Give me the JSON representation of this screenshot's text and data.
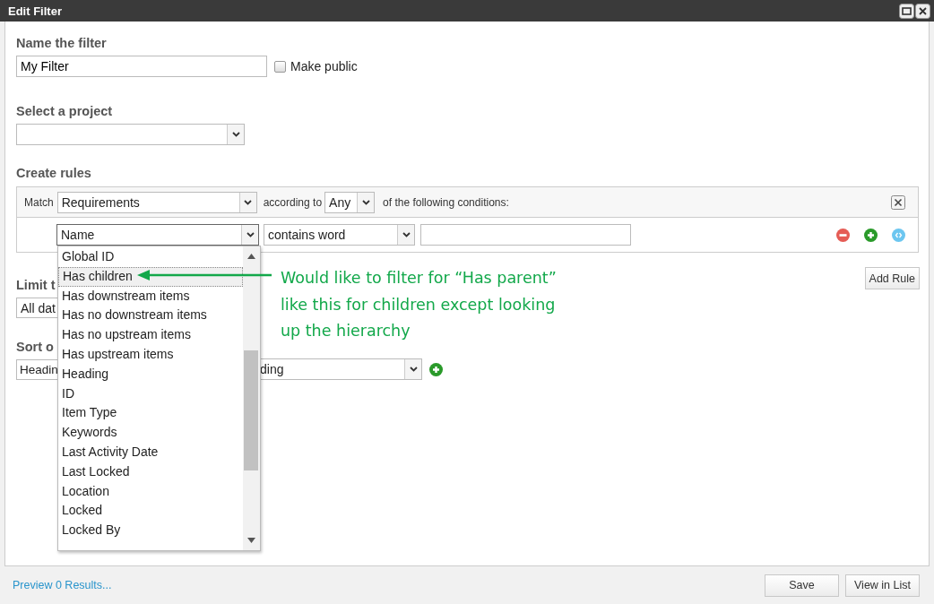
{
  "window": {
    "title": "Edit Filter"
  },
  "name_section": {
    "label": "Name the filter",
    "value": "My Filter",
    "make_public": {
      "label": "Make public",
      "checked": false
    }
  },
  "project_section": {
    "label": "Select a project"
  },
  "rules_section": {
    "label": "Create rules",
    "match_label": "Match",
    "match_value": "Requirements",
    "according_label": "according to",
    "according_value": "Any",
    "conditions_label": "of the following conditions:",
    "rule": {
      "field": "Name",
      "operator": "contains word"
    },
    "field_options": [
      {
        "label": "Global ID",
        "selected": false
      },
      {
        "label": "Has children",
        "selected": true
      },
      {
        "label": "Has downstream items",
        "selected": false
      },
      {
        "label": "Has no downstream items",
        "selected": false
      },
      {
        "label": "Has no upstream items",
        "selected": false
      },
      {
        "label": "Has upstream items",
        "selected": false
      },
      {
        "label": "Heading",
        "selected": false
      },
      {
        "label": "ID",
        "selected": false
      },
      {
        "label": "Item Type",
        "selected": false
      },
      {
        "label": "Keywords",
        "selected": false
      },
      {
        "label": "Last Activity Date",
        "selected": false
      },
      {
        "label": "Last Locked",
        "selected": false
      },
      {
        "label": "Location",
        "selected": false
      },
      {
        "label": "Locked",
        "selected": false
      },
      {
        "label": "Locked By",
        "selected": false
      }
    ],
    "add_rule_button": "Add Rule"
  },
  "limit_section": {
    "label": "Limit t",
    "value": "All dat"
  },
  "sort_section": {
    "label": "Sort o",
    "field_value": "Headin",
    "order_value": "ding"
  },
  "annotation": {
    "lines": [
      "Would like to filter for “Has parent”",
      "like this for children except looking",
      "up the hierarchy"
    ]
  },
  "footer": {
    "preview_link": "Preview 0 Results...",
    "buttons": [
      "Save",
      "View in List"
    ]
  }
}
